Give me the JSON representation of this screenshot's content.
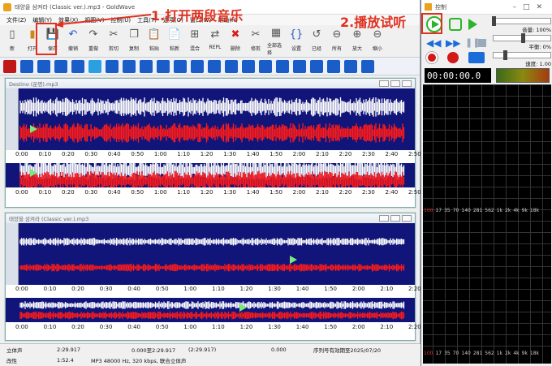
{
  "app": {
    "title": "태양을 삼켜라 (Classic ver.).mp3 - GoldWave"
  },
  "menu": [
    "文件(Z)",
    "编辑(Y)",
    "效果(X)",
    "视图(V)",
    "控制(U)",
    "工具(T)",
    "选项(O)",
    "窗口(W)",
    "帮助(H)"
  ],
  "toolbar": {
    "buttons": [
      {
        "label": "新",
        "icon": "new-file-icon"
      },
      {
        "label": "打开",
        "icon": "open-folder-icon"
      },
      {
        "label": "保存",
        "icon": "save-icon"
      },
      {
        "label": "撤销",
        "icon": "undo-icon"
      },
      {
        "label": "重做",
        "icon": "redo-icon"
      },
      {
        "label": "剪切",
        "icon": "cut-icon"
      },
      {
        "label": "复制",
        "icon": "copy-icon"
      },
      {
        "label": "粘贴",
        "icon": "paste-icon"
      },
      {
        "label": "粘新",
        "icon": "paste-new-icon"
      },
      {
        "label": "混合",
        "icon": "mix-icon"
      },
      {
        "label": "REPL",
        "icon": "replace-icon"
      },
      {
        "label": "删除",
        "icon": "delete-icon"
      },
      {
        "label": "修剪",
        "icon": "trim-icon"
      },
      {
        "label": "全部选择",
        "icon": "select-all-icon"
      },
      {
        "label": "设置",
        "icon": "settings-icon"
      },
      {
        "label": "已经",
        "icon": "done-icon"
      },
      {
        "label": "所有",
        "icon": "zoom-all-icon"
      },
      {
        "label": "放大",
        "icon": "zoom-in-icon"
      },
      {
        "label": "缩小",
        "icon": "zoom-out-icon"
      }
    ]
  },
  "annotations": {
    "step1": "1.打开两段音乐",
    "step2": "2.播放试听"
  },
  "doc1": {
    "title": "Destino (운명).mp3",
    "ticks": [
      "0:00",
      "0:10",
      "0:20",
      "0:30",
      "0:40",
      "0:50",
      "1:00",
      "1:10",
      "1:20",
      "1:30",
      "1:40",
      "1:50",
      "2:00",
      "2:10",
      "2:20",
      "2:30",
      "2:40",
      "2:50"
    ]
  },
  "doc2": {
    "title": "태양을 삼켜라 (Classic ver.).mp3",
    "ticks": [
      "0:00",
      "0:10",
      "0:20",
      "0:30",
      "0:40",
      "0:50",
      "1:00",
      "1:10",
      "1:20",
      "1:30",
      "1:40",
      "1:50",
      "2:00",
      "2:10",
      "2:20"
    ]
  },
  "status": {
    "row1": {
      "mode": "立体声",
      "length": "2:29.917",
      "selection": "0.000至2:29.917",
      "zoom": "(2:29.917)",
      "pos": "0.000",
      "license": "序列号有效期至2025/07/20"
    },
    "row2": {
      "state": "改性",
      "time": "1:52.4",
      "format": "MP3 48000 Hz, 320 kbps, 联合立体声"
    }
  },
  "control": {
    "title": "控制",
    "volume": "音量: 100%",
    "balance": "平衡: 0%",
    "speed": "速度: 1.00",
    "time": "00:00:00.0",
    "db_labels": [
      "100",
      "17",
      "35",
      "70",
      "140",
      "281",
      "562",
      "1k",
      "2k",
      "4k",
      "9k",
      "18k"
    ]
  },
  "colors": {
    "wave_bg": "#11157a",
    "wave_white": "#ffffff",
    "wave_red": "#ff1a1a",
    "annotation": "#e0301e",
    "play_green": "#2bb52b"
  }
}
